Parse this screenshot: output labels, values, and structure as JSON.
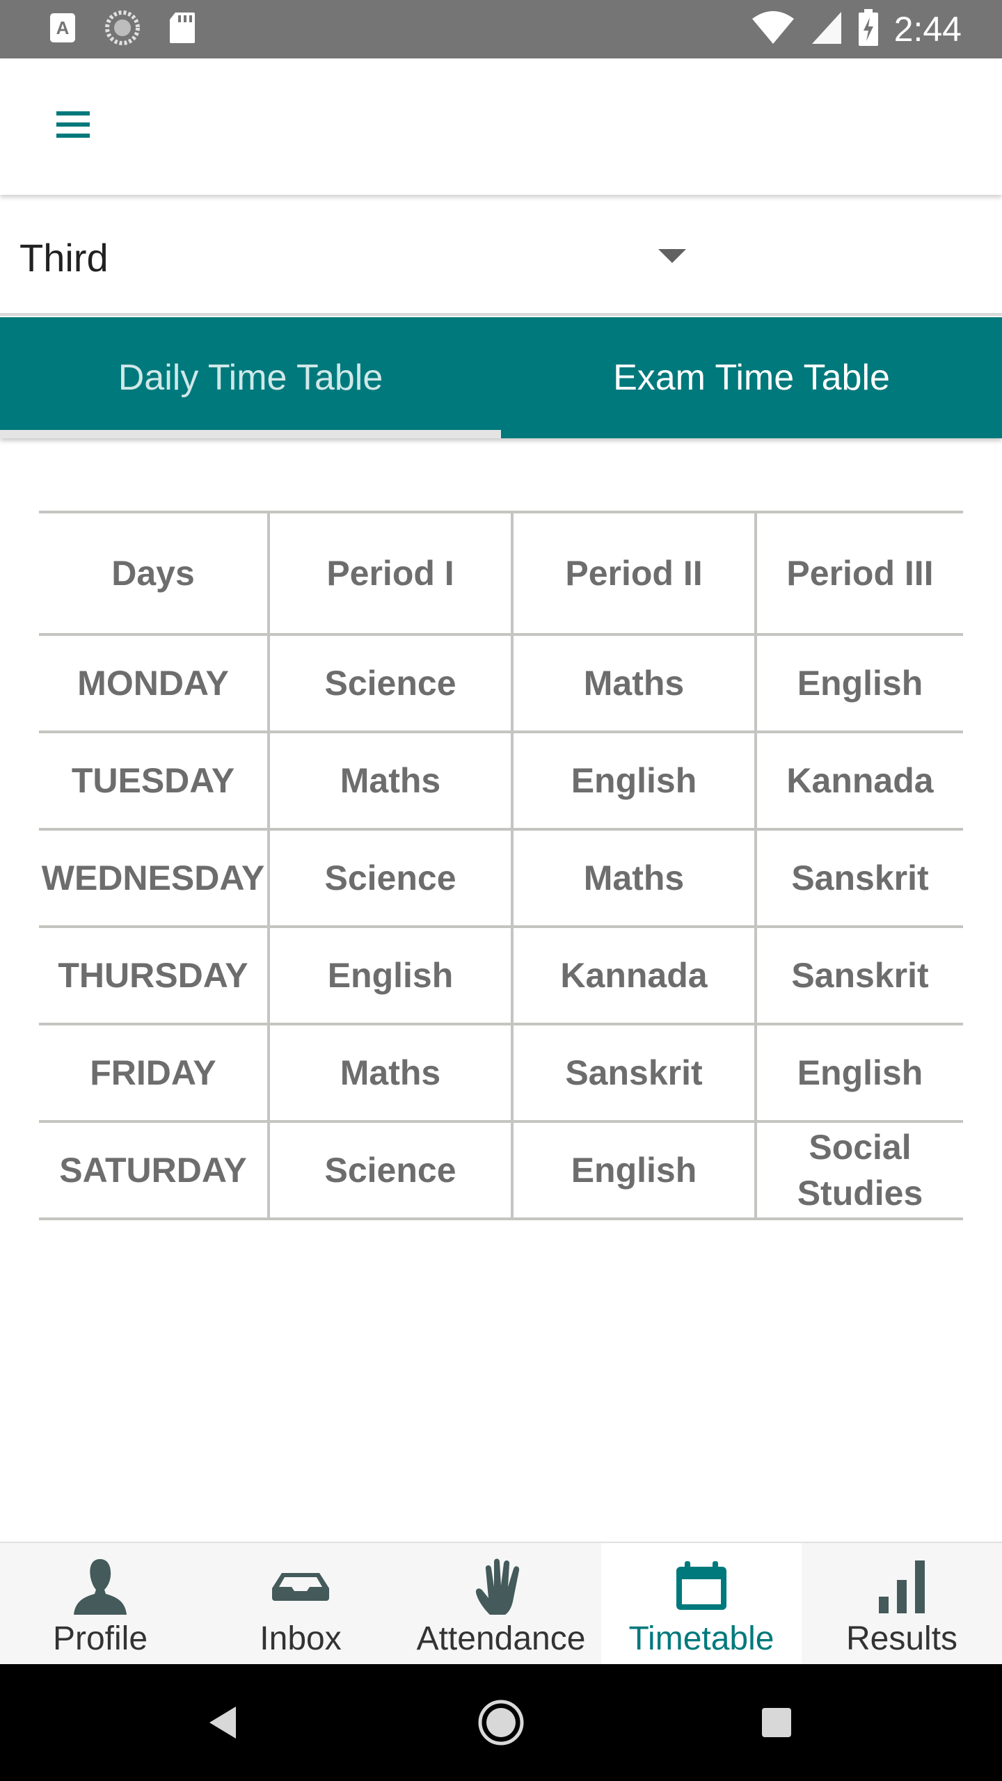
{
  "status_bar": {
    "time": "2:44",
    "icons": [
      "text-a-icon",
      "sync-icon",
      "sd-card-icon",
      "wifi-icon",
      "signal-icon",
      "battery-charging-icon"
    ]
  },
  "app_bar": {
    "menu_icon": "menu-icon"
  },
  "class_selector": {
    "selected": "Third"
  },
  "tabs": [
    {
      "label": "Daily Time Table",
      "active": true
    },
    {
      "label": "Exam Time Table",
      "active": false
    }
  ],
  "timetable": {
    "headers": [
      "Days",
      "Period I",
      "Period II",
      "Period III"
    ],
    "rows": [
      [
        "MONDAY",
        "Science",
        "Maths",
        "English"
      ],
      [
        "TUESDAY",
        "Maths",
        "English",
        "Kannada"
      ],
      [
        "WEDNESDAY",
        "Science",
        "Maths",
        "Sanskrit"
      ],
      [
        "THURSDAY",
        "English",
        "Kannada",
        "Sanskrit"
      ],
      [
        "FRIDAY",
        "Maths",
        "Sanskrit",
        "English"
      ],
      [
        "SATURDAY",
        "Science",
        "English",
        "Social Studies"
      ]
    ]
  },
  "bottom_nav": [
    {
      "label": "Profile",
      "icon": "profile-icon"
    },
    {
      "label": "Inbox",
      "icon": "inbox-icon"
    },
    {
      "label": "Attendance",
      "icon": "hand-icon"
    },
    {
      "label": "Timetable",
      "icon": "calendar-icon",
      "active": true
    },
    {
      "label": "Results",
      "icon": "bar-chart-icon"
    }
  ],
  "colors": {
    "primary": "#00797c",
    "status_bar": "#757575",
    "table_text": "#6d6d6d",
    "table_border": "#c4c4c0"
  }
}
